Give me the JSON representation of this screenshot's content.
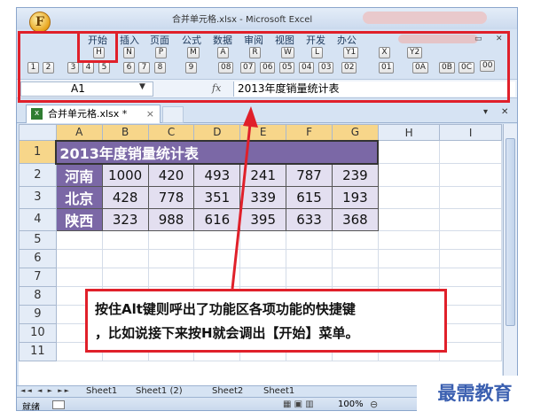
{
  "window": {
    "title": "合并单元格.xlsx - Microsoft Excel",
    "office_button_label": "F"
  },
  "ribbon": {
    "tabs": [
      {
        "label": "开始"
      },
      {
        "label": "插入"
      },
      {
        "label": "页面"
      },
      {
        "label": "公式"
      },
      {
        "label": "数据"
      },
      {
        "label": "审阅"
      },
      {
        "label": "视图"
      },
      {
        "label": "开发"
      },
      {
        "label": "办公"
      }
    ],
    "tab_keytips": [
      "H",
      "N",
      "P",
      "M",
      "A",
      "R",
      "W",
      "L",
      "Y1",
      "X",
      "Y2"
    ],
    "quick_access_keytips": [
      "1",
      "2",
      "3",
      "4",
      "5",
      "6",
      "7",
      "8",
      "9",
      "08",
      "07",
      "06",
      "05",
      "04",
      "03",
      "02",
      "01",
      "0A",
      "0B",
      "0C",
      "00"
    ]
  },
  "formula_bar": {
    "name_box": "A1",
    "fx_label": "fx",
    "formula": "2013年度销量统计表"
  },
  "document": {
    "tab_label": "合并单元格.xlsx *",
    "close_glyph": "×"
  },
  "sheet": {
    "column_headers": [
      "A",
      "B",
      "C",
      "D",
      "E",
      "F",
      "G",
      "H",
      "I"
    ],
    "row_headers": [
      "1",
      "2",
      "3",
      "4",
      "5",
      "6",
      "7",
      "8",
      "9",
      "10",
      "11"
    ],
    "title": "2013年度销量统计表",
    "rows": [
      {
        "city": "河南",
        "values": [
          "1000",
          "420",
          "493",
          "241",
          "787",
          "239"
        ]
      },
      {
        "city": "北京",
        "values": [
          "428",
          "778",
          "351",
          "339",
          "615",
          "193"
        ]
      },
      {
        "city": "陕西",
        "values": [
          "323",
          "988",
          "616",
          "395",
          "633",
          "368"
        ]
      }
    ]
  },
  "sheet_tabs": [
    "Sheet1",
    "Sheet1 (2)",
    "Sheet2",
    "Sheet1"
  ],
  "status": {
    "mode": "就绪",
    "zoom": "100%"
  },
  "annotation": {
    "line1": "按住Alt键则呼出了功能区各项功能的快捷键",
    "line2": "，比如说接下来按H就会调出【开始】菜单。"
  },
  "watermark": "最需教育",
  "colors": {
    "highlight_red": "#e0202a",
    "header_purple": "#7b68a6",
    "cell_lavender": "#e3dff0"
  }
}
